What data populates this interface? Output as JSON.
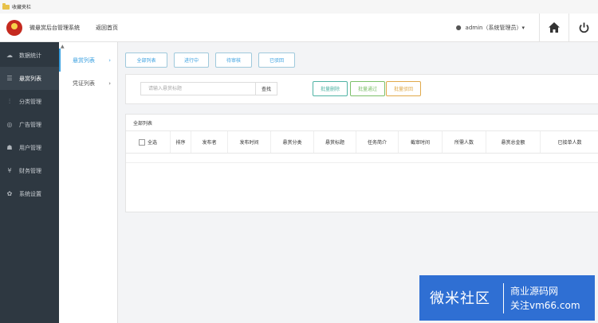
{
  "bookmarks_bar": {
    "folder_label": "收藏夹栏"
  },
  "header": {
    "site_title": "微悬赏后台管理系统",
    "home_link": "返回首页",
    "user_label": "admin（系统管理员）▾"
  },
  "sidebar": {
    "items": [
      {
        "icon": "☁",
        "label": "数据统计"
      },
      {
        "icon": "☰",
        "label": "悬赏列表"
      },
      {
        "icon": "⫶",
        "label": "分类管理"
      },
      {
        "icon": "◎",
        "label": "广告管理"
      },
      {
        "icon": "☗",
        "label": "用户管理"
      },
      {
        "icon": "¥",
        "label": "财务管理"
      },
      {
        "icon": "✿",
        "label": "系统设置"
      }
    ]
  },
  "subnav": {
    "items": [
      {
        "label": "悬赏列表",
        "chevron": "›"
      },
      {
        "label": "凭证列表",
        "chevron": "›"
      }
    ]
  },
  "filter_tabs": [
    "全部列表",
    "进行中",
    "待审核",
    "已驳回"
  ],
  "search": {
    "placeholder": "请输入悬赏标题",
    "button": "查找"
  },
  "batch_buttons": [
    "批量删除",
    "批量通过",
    "批量驳回"
  ],
  "colors": {
    "batch_delete": "#4fb3a4",
    "batch_pass": "#7cc06a",
    "batch_reject": "#e0a94a",
    "accent": "#3aa0e0",
    "sidebar_bg": "#2e3841"
  },
  "table": {
    "title": "全部列表",
    "columns": [
      "全选",
      "排序",
      "发布者",
      "发布时间",
      "悬赏分类",
      "悬赏标题",
      "任务简介",
      "截审时间",
      "所需人数",
      "悬赏总金额",
      "已接单人数"
    ]
  },
  "watermark": {
    "main": "微米社区",
    "line1": "商业源码网",
    "line2": "关注vm66.com"
  }
}
